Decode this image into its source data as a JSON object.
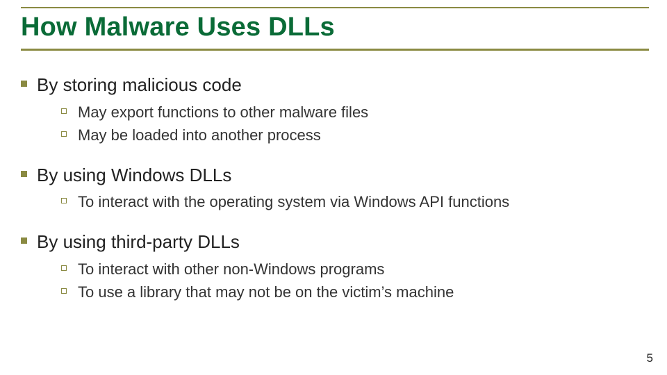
{
  "title": "How Malware Uses DLLs",
  "sections": [
    {
      "heading": "By storing malicious code",
      "items": [
        "May export functions to other malware files",
        "May be loaded into another process"
      ]
    },
    {
      "heading": "By using Windows DLLs",
      "items": [
        "To interact with the operating system via Windows API functions"
      ]
    },
    {
      "heading": "By using third-party DLLs",
      "items": [
        "To interact with other non-Windows programs",
        "To use a library that may not be on the victim’s machine"
      ]
    }
  ],
  "page_number": "5"
}
